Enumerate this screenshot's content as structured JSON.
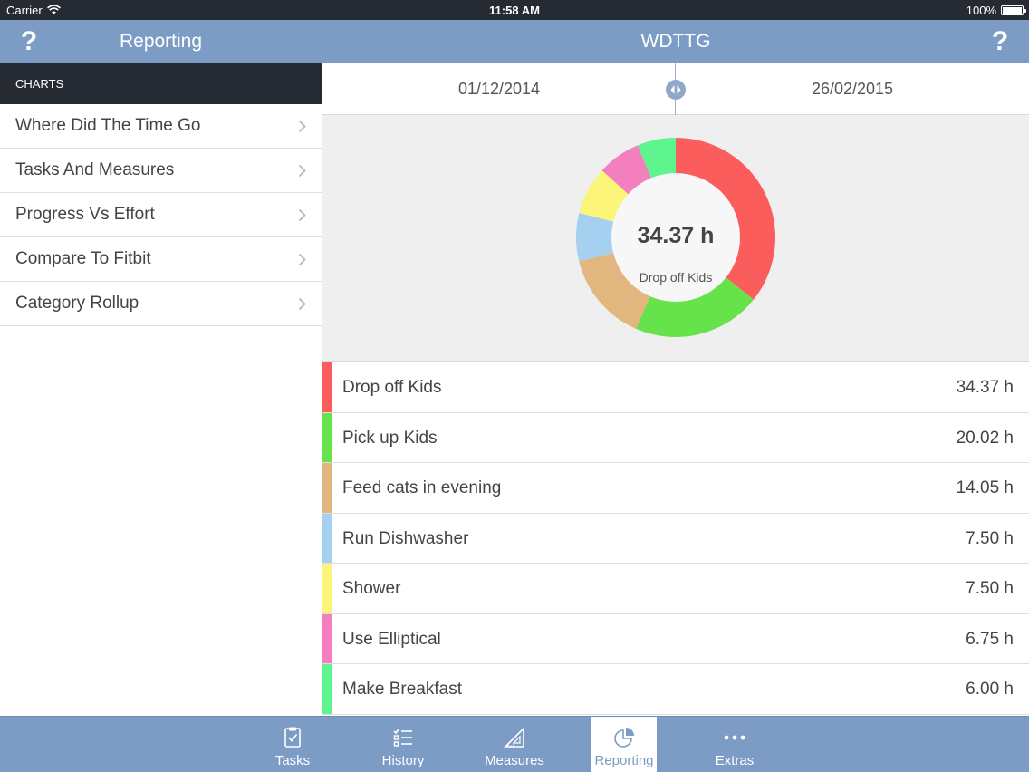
{
  "status_bar": {
    "carrier": "Carrier",
    "time": "11:58 AM",
    "battery": "100%"
  },
  "sidebar": {
    "help_label": "?",
    "title": "Reporting",
    "section_header": "CHARTS",
    "items": [
      {
        "label": "Where Did The Time Go"
      },
      {
        "label": "Tasks And Measures"
      },
      {
        "label": "Progress Vs Effort"
      },
      {
        "label": "Compare To Fitbit"
      },
      {
        "label": "Category Rollup"
      }
    ]
  },
  "main": {
    "title": "WDTTG",
    "help_label": "?",
    "date_start": "01/12/2014",
    "date_end": "26/02/2015",
    "center_value": "34.37 h",
    "center_label": "Drop off Kids"
  },
  "chart_data": {
    "type": "pie",
    "unit": "h",
    "categories": [
      "Drop off Kids",
      "Pick up Kids",
      "Feed cats in evening",
      "Run Dishwasher",
      "Shower",
      "Use Elliptical",
      "Make Breakfast"
    ],
    "values": [
      34.37,
      20.02,
      14.05,
      7.5,
      7.5,
      6.75,
      6.0
    ],
    "value_labels": [
      "34.37 h",
      "20.02 h",
      "14.05 h",
      "7.50 h",
      "7.50 h",
      "6.75 h",
      "6.00 h"
    ],
    "colors": [
      "#fb5d5d",
      "#66e24a",
      "#e1b67f",
      "#a6d0f0",
      "#fbf57a",
      "#f37fbf",
      "#5ef58f"
    ]
  },
  "tabs": [
    {
      "label": "Tasks",
      "icon": "clipboard-check-icon"
    },
    {
      "label": "History",
      "icon": "checklist-icon"
    },
    {
      "label": "Measures",
      "icon": "set-square-icon"
    },
    {
      "label": "Reporting",
      "icon": "pie-chart-icon",
      "active": true
    },
    {
      "label": "Extras",
      "icon": "more-dots-icon"
    }
  ],
  "colors": {
    "nav": "#7c9cc6",
    "dark": "#262b33",
    "panel": "#efefef"
  }
}
